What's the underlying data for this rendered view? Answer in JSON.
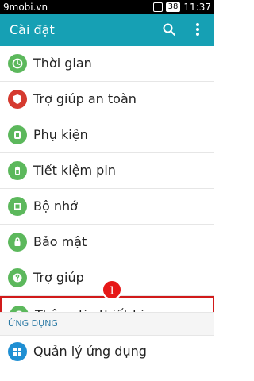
{
  "status": {
    "left_text": "9mobi.vn",
    "badge": "38",
    "time": "11:37"
  },
  "header": {
    "title": "Cài đặt"
  },
  "list": [
    {
      "label": "Thời gian",
      "icon": "clock-icon",
      "color": "#5cb85c"
    },
    {
      "label": "Trợ giúp an toàn",
      "icon": "shield-icon",
      "color": "#d53a2f"
    },
    {
      "label": "Phụ kiện",
      "icon": "accessory-icon",
      "color": "#5cb85c"
    },
    {
      "label": "Tiết kiệm pin",
      "icon": "battery-icon",
      "color": "#5cb85c"
    },
    {
      "label": "Bộ nhớ",
      "icon": "storage-icon",
      "color": "#5cb85c"
    },
    {
      "label": "Bảo mật",
      "icon": "lock-icon",
      "color": "#5cb85c"
    },
    {
      "label": "Trợ giúp",
      "icon": "help-icon",
      "color": "#5cb85c"
    },
    {
      "label": "Thông tin thiết bị",
      "icon": "info-icon",
      "color": "#5cb85c"
    }
  ],
  "callout": {
    "number": "1"
  },
  "section": {
    "title": "ỨNG DỤNG"
  },
  "bottom_item": {
    "label": "Quản lý ứng dụng",
    "icon": "apps-icon",
    "color": "#1f8fd3"
  }
}
